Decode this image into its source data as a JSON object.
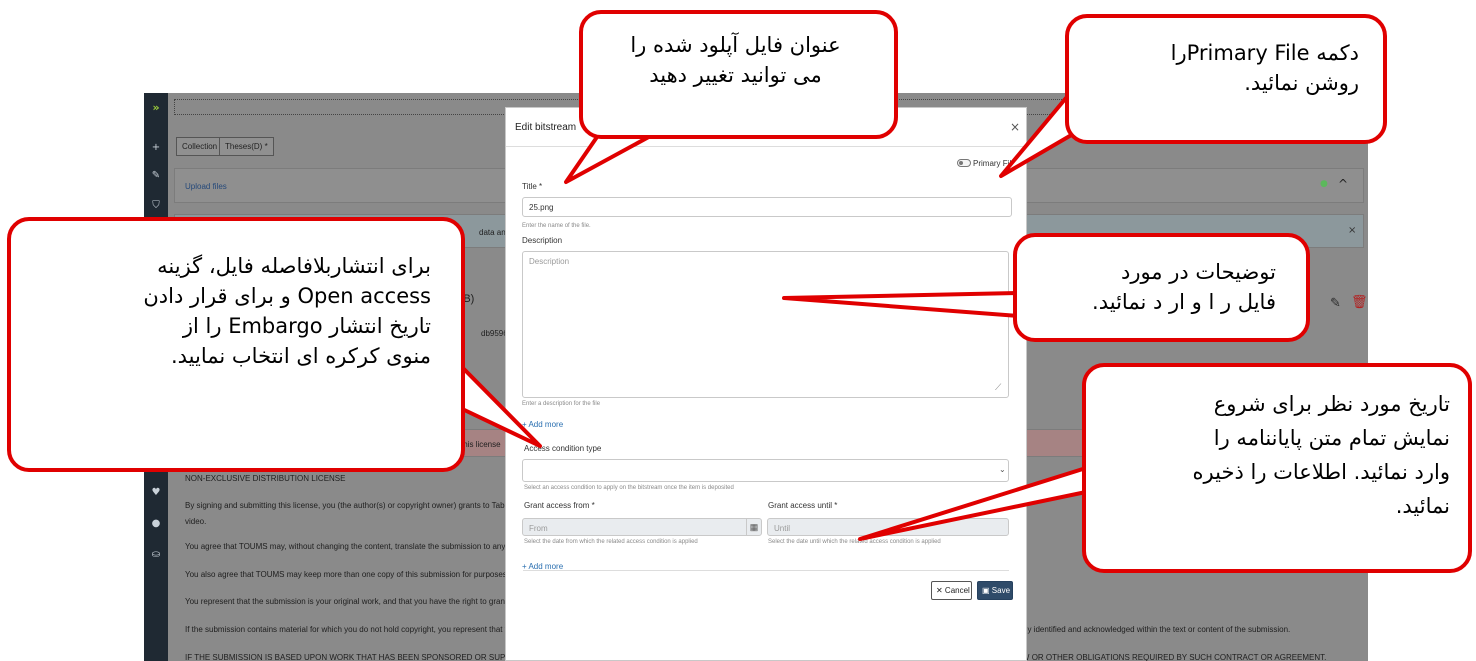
{
  "app": {
    "logo": "»",
    "sidebar_icons": [
      "+",
      "✎",
      "⛉",
      "♥",
      "●",
      "⛀"
    ],
    "collection_label": "Collection",
    "collection_value": "Theses(D) *",
    "upload_files": "Upload files",
    "fragments": {
      "data_access": "data and access",
      "kb": "KB)",
      "hash": "db9596b3a2",
      "this_license": "this license",
      "license_title": "NON-EXCLUSIVE DISTRIBUTION LICENSE",
      "p1": "By signing and submitting this license, you (the author(s) or copyright owner) grants to Tabriz Univ",
      "video": "video.",
      "p2": "You agree that TOUMS may, without changing the content, translate the submission to any medium",
      "p3": "You also agree that TOUMS may keep more than one copy of this submission for purposes of secur",
      "p4": "You represent that the submission is your original work, and that you have the right to grant the rig",
      "p5": "If the submission contains material for which you do not hold copyright, you represent that you hav",
      "p5_tail": "rly identified and acknowledged within the text or content of the submission.",
      "p6": "IF THE SUBMISSION IS BASED UPON WORK THAT HAS BEEN SPONSORED OR SUPPORTED BY AN AGENCY OR ORGANIZATION OTHER THAN TUMS, YOU REPRESENT THAT YOU HAVE FULFILLED ANY RIGHT OF REVIEW OR OTHER OBLIGATIONS REQUIRED BY SUCH CONTRACT OR AGREEMENT."
    }
  },
  "modal": {
    "title": "Edit bitstream",
    "close": "×",
    "primary_file_label": "Primary File",
    "title_label": "Title *",
    "title_value": "25.png",
    "title_help": "Enter the name of the file.",
    "description_label": "Description",
    "description_placeholder": "Description",
    "description_help": "Enter a description for the file",
    "add_more": "+ Add more",
    "access_label": "Access condition type",
    "access_help": "Select an access condition to apply on the bitstream once the item is deposited",
    "from_label": "Grant access from *",
    "from_placeholder": "From",
    "from_help": "Select the date from which the related access condition is applied",
    "until_label": "Grant access until *",
    "until_placeholder": "Until",
    "until_help": "Select the date until which the related access condition is applied",
    "add_more_2": "+ Add more",
    "cancel_label": "✕ Cancel",
    "save_label": "Save"
  },
  "callouts": {
    "title_note": [
      "عنوان فایل آپلود شده را",
      "می توانید تغییر دهید"
    ],
    "primary_note": [
      "دکمه  Primary Fileرا",
      "روشن نمائید."
    ],
    "access_note": [
      "برای انتشاربلافاصله فایل، گزینه",
      "Open access  و برای قرار دادن",
      "تاریخ انتشار  Embargo را از",
      "منوی کرکره ای انتخاب نمایید."
    ],
    "description_note": [
      "توضیحات در مورد",
      "فایل ر ا و ار د نمائید."
    ],
    "date_note": [
      "تاریخ مورد نظر برای شروع",
      "نمایش تمام متن پایاننامه  را",
      "وارد نمائید. اطلاعات را ذخیره",
      "نمائید."
    ]
  },
  "colors": {
    "callout_border": "#e00000",
    "sidebar": "#1f2933",
    "overlay": "#8a8a8a",
    "save_button": "#2f4b69",
    "link": "#2a6fb0"
  }
}
